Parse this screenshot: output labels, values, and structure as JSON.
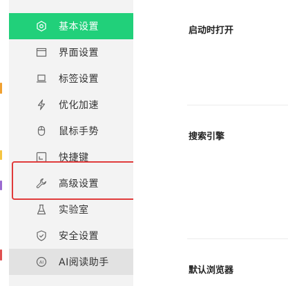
{
  "sidebar": {
    "items": [
      {
        "label": "基本设置",
        "icon": "gear-icon"
      },
      {
        "label": "界面设置",
        "icon": "window-icon"
      },
      {
        "label": "标签设置",
        "icon": "tab-icon"
      },
      {
        "label": "优化加速",
        "icon": "lightning-icon"
      },
      {
        "label": "鼠标手势",
        "icon": "mouse-icon"
      },
      {
        "label": "快捷键",
        "icon": "shortcut-icon"
      },
      {
        "label": "高级设置",
        "icon": "wrench-icon"
      },
      {
        "label": "实验室",
        "icon": "flask-icon"
      },
      {
        "label": "安全设置",
        "icon": "shield-icon"
      },
      {
        "label": "AI阅读助手",
        "icon": "ai-icon"
      }
    ]
  },
  "content": {
    "sections": [
      {
        "title": "启动时打开"
      },
      {
        "title": "搜索引擎"
      },
      {
        "title": "默认浏览器"
      }
    ]
  },
  "colors": {
    "accent": "#21d07a",
    "highlight_border": "#e03a3a",
    "sidebar_bg": "#f3f3f3"
  }
}
